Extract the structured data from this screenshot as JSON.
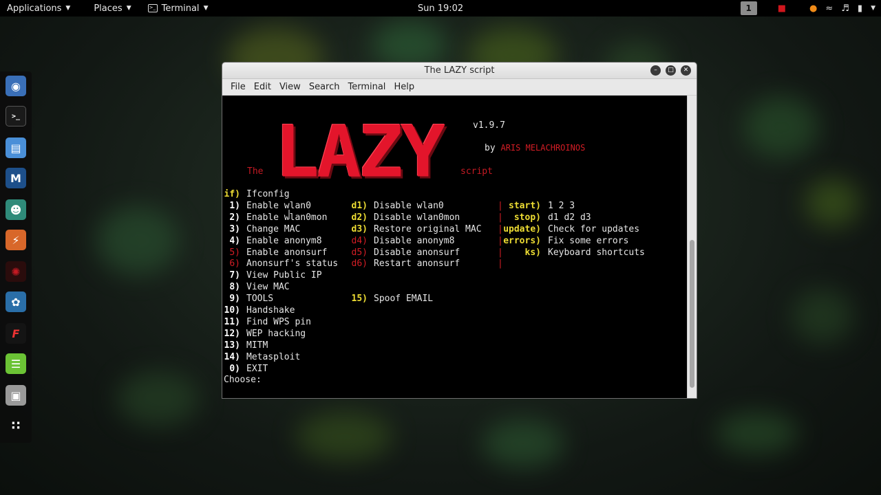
{
  "topbar": {
    "applications": "Applications",
    "places": "Places",
    "terminal": "Terminal",
    "clock": "Sun 19:02",
    "workspace": "1"
  },
  "dock": {
    "items": [
      "web-browser",
      "terminal",
      "files",
      "metasploit",
      "armitage",
      "burpsuite",
      "faraday",
      "maltego",
      "beef",
      "text-editor",
      "disk",
      "app-grid"
    ]
  },
  "window": {
    "title": "The LAZY script",
    "menu": [
      "File",
      "Edit",
      "View",
      "Search",
      "Terminal",
      "Help"
    ]
  },
  "banner": {
    "logo": "LAZY",
    "the": "The",
    "script": "script",
    "version": "v1.9.7",
    "by": "by",
    "author": "ARIS MELACHROINOS"
  },
  "menu_col1": [
    {
      "key": "if)",
      "label": "Ifconfig"
    },
    {
      "key": "1)",
      "label": "Enable wlan0"
    },
    {
      "key": "2)",
      "label": "Enable wlan0mon"
    },
    {
      "key": "3)",
      "label": "Change MAC"
    },
    {
      "key": "4)",
      "label": "Enable anonym8"
    },
    {
      "key": "5)",
      "label": "Enable anonsurf"
    },
    {
      "key": "6)",
      "label": "Anonsurf's status"
    },
    {
      "key": "7)",
      "label": "View Public IP"
    },
    {
      "key": "8)",
      "label": "View MAC"
    },
    {
      "key": "9)",
      "label": "TOOLS"
    },
    {
      "key": "10)",
      "label": "Handshake"
    },
    {
      "key": "11)",
      "label": "Find WPS pin"
    },
    {
      "key": "12)",
      "label": "WEP hacking"
    },
    {
      "key": "13)",
      "label": "MITM"
    },
    {
      "key": "14)",
      "label": "Metasploit"
    },
    {
      "key": "0)",
      "label": "EXIT"
    }
  ],
  "menu_col2": [
    {
      "key": "d1)",
      "label": "Disable wlan0"
    },
    {
      "key": "d2)",
      "label": "Disable wlan0mon"
    },
    {
      "key": "d3)",
      "label": "Restore original MAC"
    },
    {
      "key": "d4)",
      "label": "Disable anonym8"
    },
    {
      "key": "d5)",
      "label": "Disable anonsurf"
    },
    {
      "key": "d6)",
      "label": "Restart anonsurf"
    },
    {
      "key": "15)",
      "label": "Spoof EMAIL"
    }
  ],
  "menu_col3": [
    {
      "key": "start)",
      "label": "1 2 3"
    },
    {
      "key": "stop)",
      "label": "d1 d2 d3"
    },
    {
      "key": "update)",
      "label": "Check for updates"
    },
    {
      "key": "errors)",
      "label": "Fix some errors"
    },
    {
      "key": "ks)",
      "label": "Keyboard shortcuts"
    }
  ],
  "prompt": "Choose:",
  "separator": "|"
}
